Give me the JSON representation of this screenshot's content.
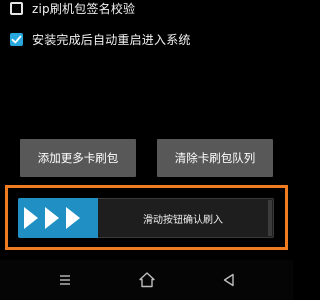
{
  "options": [
    {
      "label": "zip刷机包签名校验",
      "checked": false
    },
    {
      "label": "安装完成后自动重启进入系统",
      "checked": true
    }
  ],
  "buttons": {
    "add_label": "添加更多卡刷包",
    "clear_label": "清除卡刷包队列"
  },
  "swipe": {
    "label": "滑动按钮确认刷入"
  },
  "icons": {
    "checkbox_unchecked": "checkbox-unchecked-icon",
    "checkbox_checked": "checkbox-checked-icon",
    "swipe_arrows": "triple-chevron-right-icon",
    "menu": "menu-icon",
    "home": "home-icon",
    "back": "back-icon"
  },
  "colors": {
    "background": "#000000",
    "accent": "#1f8fc4",
    "checkbox_checked": "#27a7dc",
    "button_bg": "#585858",
    "highlight_outline": "#f07c22",
    "swipe_track": "#1e1e1e"
  }
}
